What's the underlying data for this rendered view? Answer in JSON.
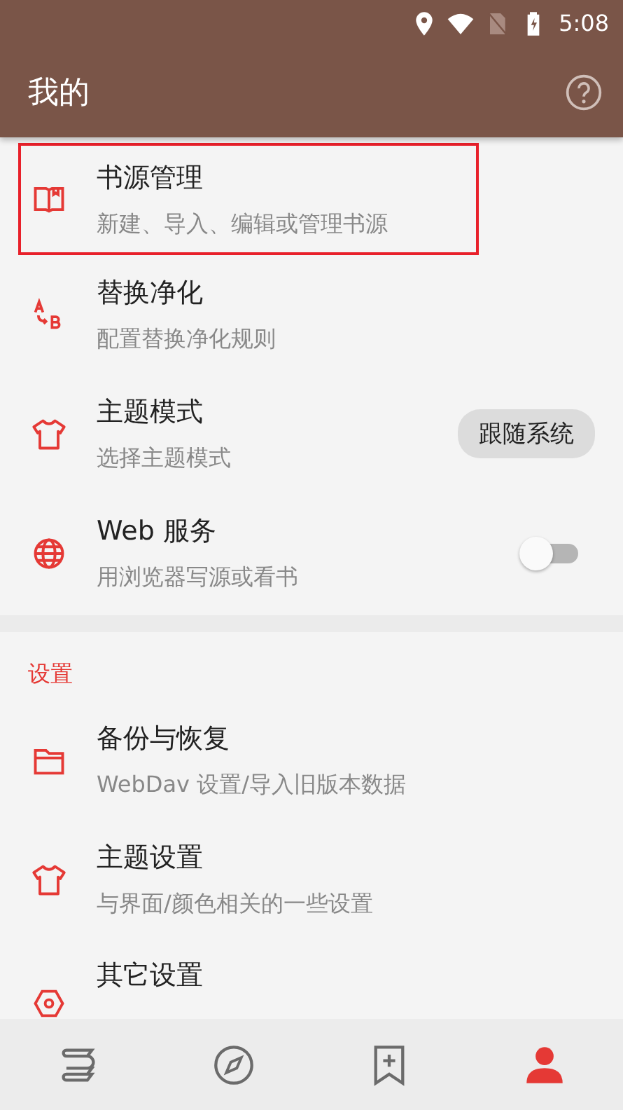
{
  "status_bar": {
    "time": "5:08"
  },
  "toolbar": {
    "title": "我的"
  },
  "main_items": [
    {
      "kind": "plain",
      "title": "书源管理",
      "subtitle": "新建、导入、编辑或管理书源",
      "highlighted": true
    },
    {
      "kind": "plain",
      "title": "替换净化",
      "subtitle": "配置替换净化规则",
      "highlighted": false
    },
    {
      "kind": "chip",
      "title": "主题模式",
      "subtitle": "选择主题模式",
      "value": "跟随系统",
      "highlighted": false
    },
    {
      "kind": "switch",
      "title": "Web 服务",
      "subtitle": "用浏览器写源或看书",
      "on": false,
      "highlighted": false
    }
  ],
  "settings_section": {
    "header": "设置",
    "items": [
      {
        "title": "备份与恢复",
        "subtitle": "WebDav 设置/导入旧版本数据"
      },
      {
        "title": "主题设置",
        "subtitle": "与界面/颜色相关的一些设置"
      },
      {
        "title": "其它设置"
      }
    ]
  },
  "bottom_nav": [
    {
      "selected": false
    },
    {
      "selected": false
    },
    {
      "selected": false
    },
    {
      "selected": true
    }
  ]
}
